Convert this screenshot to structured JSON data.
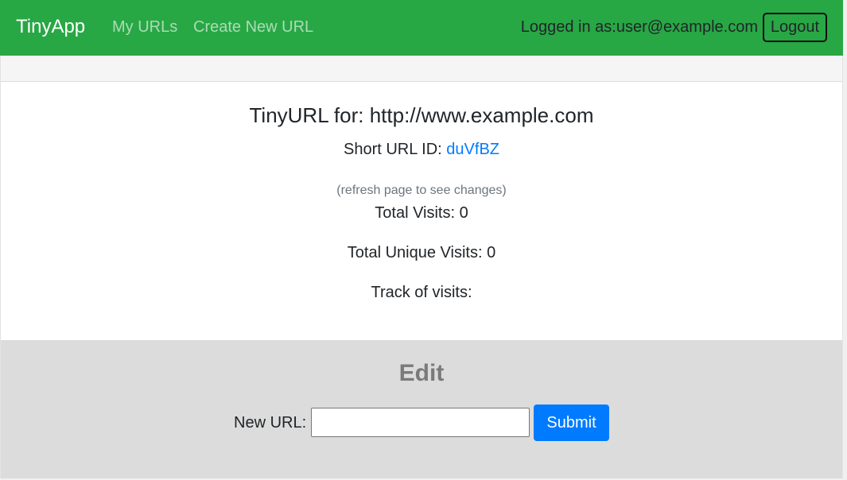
{
  "navbar": {
    "brand": "TinyApp",
    "links": [
      {
        "label": "My URLs"
      },
      {
        "label": "Create New URL"
      }
    ],
    "login_text": "Logged in as:user@example.com",
    "logout_label": "Logout",
    "bg_color": "#28a745"
  },
  "main": {
    "title": "TinyURL for: http://www.example.com",
    "short_url_label": "Short URL ID: ",
    "short_url_id": "duVfBZ",
    "refresh_note": "(refresh page to see changes)",
    "total_visits": "Total Visits: 0",
    "unique_visits": "Total Unique Visits: 0",
    "track_visits": "Track of visits:"
  },
  "edit": {
    "heading": "Edit",
    "new_url_label": "New URL:",
    "new_url_value": "",
    "submit_label": "Submit",
    "submit_color": "#007bff"
  }
}
